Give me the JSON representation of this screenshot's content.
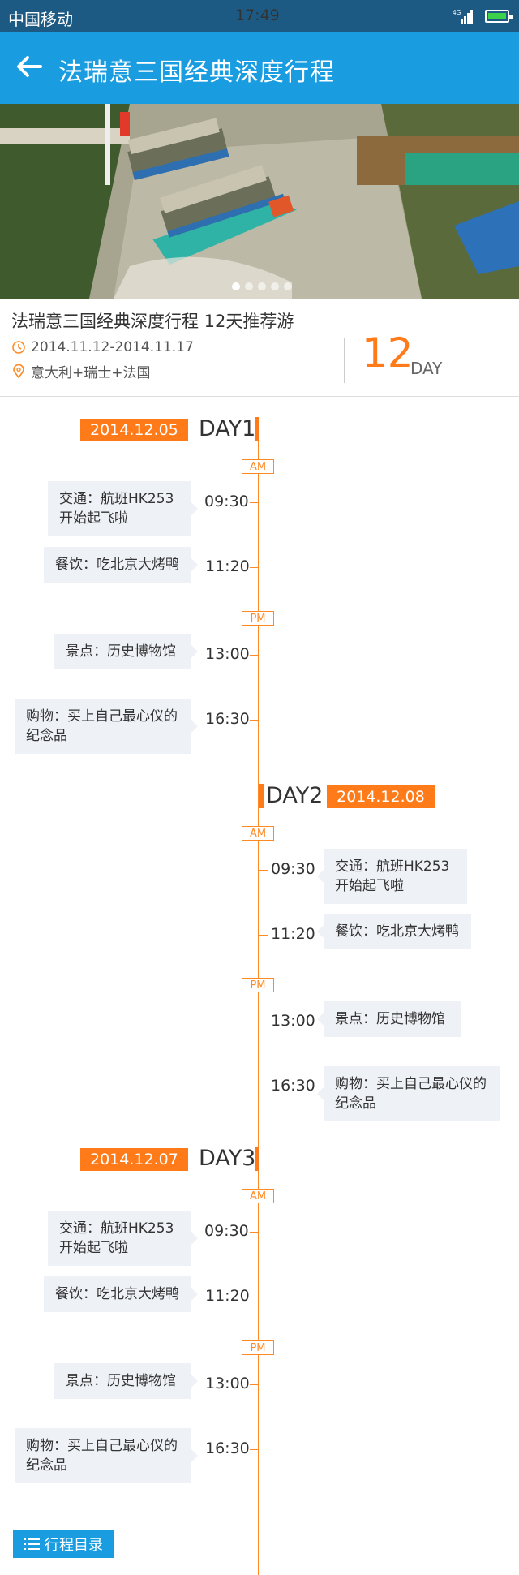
{
  "status_bar": {
    "carrier": "中国移动",
    "time": "17:49",
    "network": "4G"
  },
  "header": {
    "title": "法瑞意三国经典深度行程"
  },
  "banner": {
    "dots": 5,
    "active_dot": 1
  },
  "trip": {
    "title": "法瑞意三国经典深度行程 12天推荐游",
    "date_range": "2014.11.12-2014.11.17",
    "route": "意大利+瑞士+法国",
    "days_count": "12",
    "days_unit": "DAY"
  },
  "colors": {
    "primary": "#1a9de0",
    "accent": "#ff7b1a",
    "status_bar": "#1d5a83"
  },
  "days": [
    {
      "date": "2014.12.05",
      "label": "DAY1",
      "am": "AM",
      "pm": "PM",
      "events": [
        {
          "time": "09:30",
          "text": "交通：航班HK253 开始起飞啦"
        },
        {
          "time": "11:20",
          "text": "餐饮：吃北京大烤鸭"
        },
        {
          "time": "13:00",
          "text": "景点：历史博物馆"
        },
        {
          "time": "16:30",
          "text": "购物：买上自己最心仪的纪念品"
        }
      ]
    },
    {
      "date": "2014.12.08",
      "label": "DAY2",
      "am": "AM",
      "pm": "PM",
      "events": [
        {
          "time": "09:30",
          "text": "交通：航班HK253 开始起飞啦"
        },
        {
          "time": "11:20",
          "text": "餐饮：吃北京大烤鸭"
        },
        {
          "time": "13:00",
          "text": "景点：历史博物馆"
        },
        {
          "time": "16:30",
          "text": "购物：买上自己最心仪的纪念品"
        }
      ]
    },
    {
      "date": "2014.12.07",
      "label": "DAY3",
      "am": "AM",
      "pm": "PM",
      "events": [
        {
          "time": "09:30",
          "text": "交通：航班HK253 开始起飞啦"
        },
        {
          "time": "11:20",
          "text": "餐饮：吃北京大烤鸭"
        },
        {
          "time": "13:00",
          "text": "景点：历史博物馆"
        },
        {
          "time": "16:30",
          "text": "购物：买上自己最心仪的纪念品"
        }
      ]
    }
  ],
  "footer": {
    "toc_label": "行程目录"
  }
}
